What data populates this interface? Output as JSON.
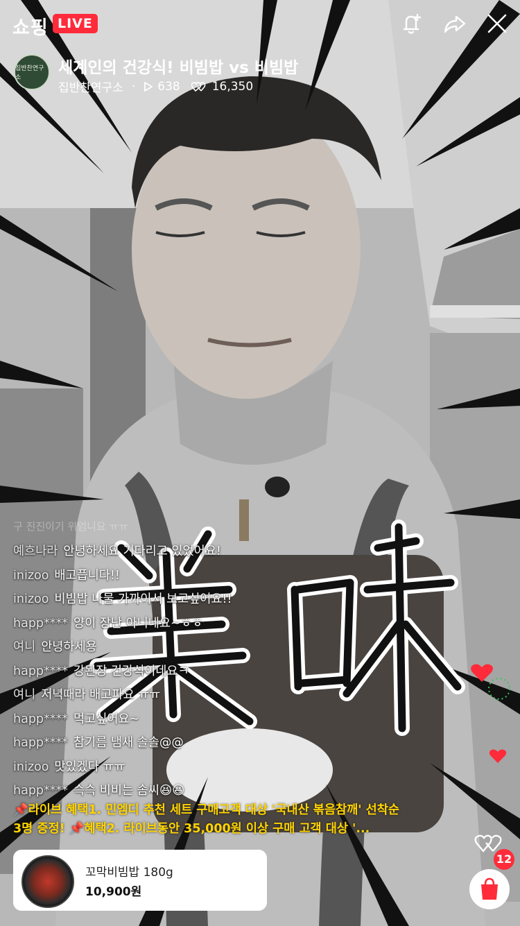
{
  "header": {
    "brand": "쇼핑",
    "live_badge": "LIVE",
    "actions": [
      "bell-plus-icon",
      "share-icon",
      "close-icon"
    ]
  },
  "channel": {
    "avatar_text": "집반찬연구소",
    "title": "세계인의 건강식! 비빔밥 vs 비빔밥",
    "name": "집반찬연구소",
    "separator": "·",
    "views": "638",
    "likes": "16,350"
  },
  "chat": {
    "faded_line": "구 진진이기 위엄니요 ㅠㅠ",
    "messages": [
      {
        "user": "예흐나라",
        "text": "안녕하세요 기다리고 있었어요!"
      },
      {
        "user": "inizoo",
        "text": "배고픕니다!!"
      },
      {
        "user": "inizoo",
        "text": "비빔밥 나물 가까이서 보고싶어요!!"
      },
      {
        "user": "happ****",
        "text": "양이 장난 아니네요~ㅎㅎ"
      },
      {
        "user": "여니",
        "text": "안녕하세용"
      },
      {
        "user": "happ****",
        "text": "강된장 건강식이네요ㅋ"
      },
      {
        "user": "여니",
        "text": "저녁때라 배고파요 ㅠㅠ"
      },
      {
        "user": "happ****",
        "text": "먹고싶어요~"
      },
      {
        "user": "happ****",
        "text": "참기름 냄새 솔솔@@"
      },
      {
        "user": "inizoo",
        "text": "맛있겠다 ㅠㅠ"
      },
      {
        "user": "happ****",
        "text": "슥슥 비비는 솜씨😆😆"
      }
    ]
  },
  "notice": {
    "text": "📌라이브 혜택1. 민엠디 추천 세트 구매고객 대상 '국내산 볶음참깨' 선착순 3명 증정! 📌혜택2. 라이브동안 35,000원 이상 구매 고객 대상 '..."
  },
  "product": {
    "name": "꼬막비빔밥 180g",
    "price": "10,900원"
  },
  "overlay": {
    "calligraphy": "美味"
  },
  "cart": {
    "count": "12"
  },
  "colors": {
    "live_red": "#ff2b3a",
    "notice_yellow": "#ffd400",
    "heart_red": "#ff2b3a"
  }
}
